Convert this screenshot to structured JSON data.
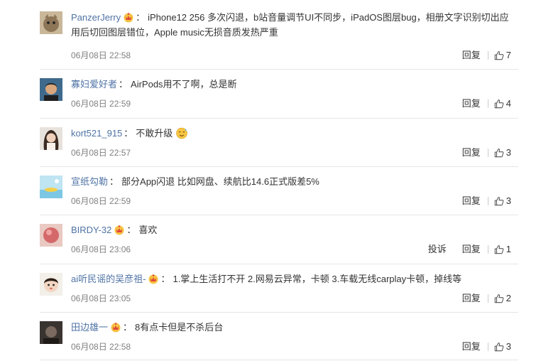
{
  "labels": {
    "reply": "回复",
    "report": "投诉"
  },
  "colors": {
    "username": "#4f73a5",
    "text": "#333333",
    "time": "#808080",
    "divider": "#e6e6e6"
  },
  "comments": [
    {
      "user": "PanzerJerry",
      "vip": true,
      "text_line1": "iPhone12 256 多次闪退，b站音量调节UI不同步，iPadOS图层bug，相册文字识别切出应",
      "text_line2": "用后切回图层错位，Apple music无损音质发热严重",
      "time": "06月08日 22:58",
      "likes": "7",
      "avatar": "cat-avatar"
    },
    {
      "user": "寡妇爱好者",
      "vip": false,
      "text": "AirPods用不了啊，总是断",
      "time": "06月08日 22:59",
      "likes": "4",
      "avatar": "person-avatar"
    },
    {
      "user": "kort521_915",
      "vip": false,
      "text": "不敢升级",
      "emoji": "sweat-smile-emoji",
      "time": "06月08日 22:57",
      "likes": "3",
      "avatar": "girl-avatar"
    },
    {
      "user": "宣纸勾勒",
      "vip": false,
      "text": "部分App闪退 比如网盘、续航比14.6正式版差5%",
      "time": "06月08日 22:59",
      "likes": "3",
      "avatar": "landscape-avatar"
    },
    {
      "user": "BIRDY-32",
      "vip": true,
      "text": "喜欢",
      "time": "06月08日 23:06",
      "likes": "1",
      "report": true,
      "avatar": "peach-avatar"
    },
    {
      "user": "ai听民谣的吴彦祖-",
      "vip": true,
      "text": "1.掌上生活打不开 2.网易云异常，卡顿 3.车载无线carplay卡顿，掉线等",
      "time": "06月08日 23:05",
      "likes": "2",
      "avatar": "child-avatar"
    },
    {
      "user": "田边雄一",
      "vip": true,
      "text": "8有点卡但是不杀后台",
      "time": "06月08日 22:58",
      "likes": "3",
      "avatar": "dark-avatar"
    }
  ]
}
